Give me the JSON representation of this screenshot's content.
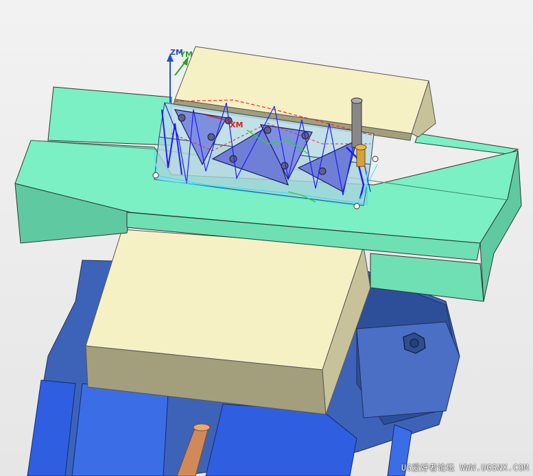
{
  "viewport": {
    "background_color": "#ececec"
  },
  "axes": {
    "zm_label": "ZM",
    "ym_label": "YM",
    "xm_label": "XM",
    "z_color": "#1f4fd1",
    "y_color": "#2aa22a",
    "x_color": "#d62020"
  },
  "colors": {
    "vise_body": "#3d63b8",
    "vise_body_dark": "#2d4f99",
    "vise_rail": "#2f5fe0",
    "parallel_plate": "#7af0c4",
    "parallel_plate_dark": "#5fcaa1",
    "jaw_top": "#f6f1c4",
    "jaw_side": "#a39f7c",
    "workpiece": "#b8dde6",
    "triangle_pocket": "#7f8fe0",
    "toolpath_blue": "#1a1aff",
    "toolpath_cyan": "#33e0ff",
    "toolpath_green": "#2bd62b",
    "toolpath_red": "#ff2020",
    "spindle_rod": "#d08a5a"
  },
  "watermark": {
    "text": "UG爱好者论坛 WWW.UGSNX.COM"
  }
}
